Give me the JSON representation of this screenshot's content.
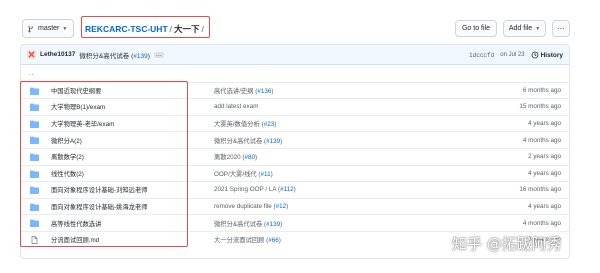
{
  "branch": {
    "label": "master"
  },
  "breadcrumb": {
    "repo": "REKCARC-TSC-UHT",
    "separator": "/",
    "folder": "大一下",
    "trailing": "/"
  },
  "actions": {
    "goto_file": "Go to file",
    "add_file": "Add file",
    "more": "···"
  },
  "commit": {
    "author": "Lethe10137",
    "message": "微积分&高代试卷",
    "pr_open": "(",
    "pr": "#139",
    "pr_close": ")",
    "ellipsis": "…",
    "hash": "1dcccfd",
    "date": "on Jul 23",
    "history": "History"
  },
  "parent_dir": "..",
  "files": [
    {
      "name": "中国近现代史纲要",
      "type": "dir",
      "msg": "高代选讲/史纲",
      "pr": "#136",
      "age": "6 months ago"
    },
    {
      "name": "大学物理B(1)/exam",
      "type": "dir",
      "msg": "add latest exam",
      "pr": "",
      "age": "15 months ago"
    },
    {
      "name": "大学物理英-老毕/exam",
      "type": "dir",
      "msg": "大雾英/数值分析",
      "pr": "#23",
      "age": "4 years ago"
    },
    {
      "name": "微积分A(2)",
      "type": "dir",
      "msg": "微积分&高代试卷",
      "pr": "#139",
      "age": "4 months ago"
    },
    {
      "name": "离散数学(2)",
      "type": "dir",
      "msg": "离散2020",
      "pr": "#80",
      "age": "2 years ago"
    },
    {
      "name": "线性代数(2)",
      "type": "dir",
      "msg": "OOP/大雾/线代",
      "pr": "#11",
      "age": "4 years ago"
    },
    {
      "name": "面向对象程序设计基础-刘知远老师",
      "type": "dir",
      "msg": "2021 Spring OOP / LA",
      "pr": "#112",
      "age": "16 months ago"
    },
    {
      "name": "面向对象程序设计基础-姚海龙老师",
      "type": "dir",
      "msg": "remove duplicate file",
      "pr": "#12",
      "age": "4 years ago"
    },
    {
      "name": "高等线性代数选讲",
      "type": "dir",
      "msg": "微积分&高代试卷",
      "pr": "#139",
      "age": "4 months ago"
    },
    {
      "name": "分流面试回顾.md",
      "type": "file",
      "msg": "大一分流面试回顾",
      "pr": "#66",
      "age": "3 years ago"
    }
  ],
  "watermark": "知乎 @拓跋阿秀",
  "colors": {
    "link": "#0366d6",
    "folder": "#79b8ff",
    "highlight": "#e05050"
  }
}
